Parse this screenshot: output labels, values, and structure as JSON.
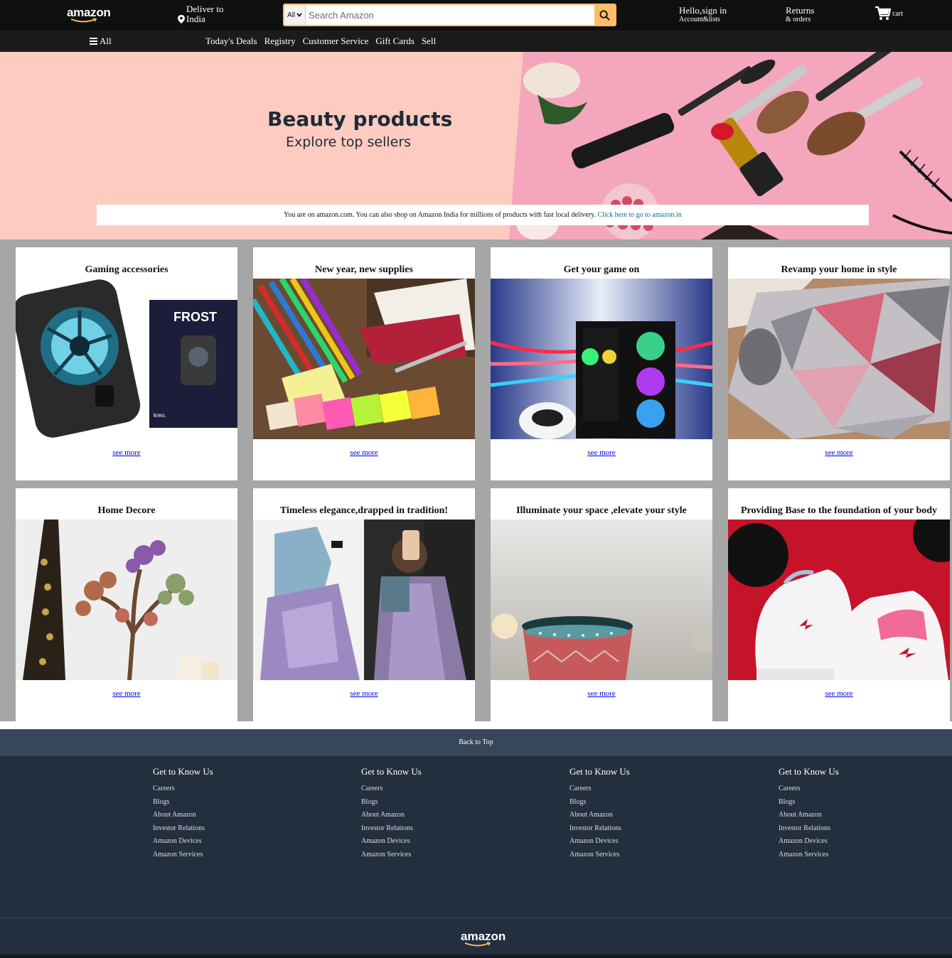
{
  "navbar": {
    "logo": "amazon",
    "deliver_line1": "Deliver to",
    "deliver_line2": "India",
    "search_category": "All",
    "search_placeholder": "Search Amazon",
    "signin_line1": "Hello,sign in",
    "signin_line2": "Account&lists",
    "returns_line1": "Returns",
    "returns_line2": "& orders",
    "cart_label": "cart",
    "accent": "#febd69"
  },
  "subnav": {
    "all_label": "All",
    "links": [
      "Today's Deals",
      "Registry",
      "Customer Service",
      "Gift Cards",
      "Sell"
    ]
  },
  "hero": {
    "title": "Beauty products",
    "subtitle": "Explore top sellers",
    "notice_text": "You are on amazon.com. You can also shop on Amazon India for millions of products with fast local delivery.",
    "notice_link": "Click here to go to amazon.in",
    "background": "#fecbc1"
  },
  "cards": [
    {
      "title": "Gaming accessories",
      "link": "see more",
      "image": "phone-cooler"
    },
    {
      "title": "New year, new supplies",
      "link": "see more",
      "image": "stationery"
    },
    {
      "title": "Get your game on",
      "link": "see more",
      "image": "gaming-pc"
    },
    {
      "title": "Revamp your home in style",
      "link": "see more",
      "image": "rug"
    },
    {
      "title": "Home Decore",
      "link": "see more",
      "image": "gem-tree"
    },
    {
      "title": "Timeless elegance,drapped in tradition!",
      "link": "see more",
      "image": "saree"
    },
    {
      "title": "Illuminate your space ,elevate your style",
      "link": "see more",
      "image": "lantern"
    },
    {
      "title": "Providing Base to the foundation of your body",
      "link": "see more",
      "image": "sneakers"
    }
  ],
  "footer": {
    "back_to_top": "Back to Top",
    "columns": [
      {
        "heading": "Get to Know Us",
        "items": [
          "Careers",
          "Blogs",
          "About Amazon",
          "Investor Relations",
          "Amazon Devices",
          "Amazon Services"
        ]
      },
      {
        "heading": "Get to Know Us",
        "items": [
          "Careers",
          "Blogs",
          "About Amazon",
          "Investor Relations",
          "Amazon Devices",
          "Amazon Services"
        ]
      },
      {
        "heading": "Get to Know Us",
        "items": [
          "Careers",
          "Blogs",
          "About Amazon",
          "Investor Relations",
          "Amazon Devices",
          "Amazon Services"
        ]
      },
      {
        "heading": "Get to Know Us",
        "items": [
          "Careers",
          "Blogs",
          "About Amazon",
          "Investor Relations",
          "Amazon Devices",
          "Amazon Services"
        ]
      }
    ],
    "bottom_logo": "amazon"
  }
}
